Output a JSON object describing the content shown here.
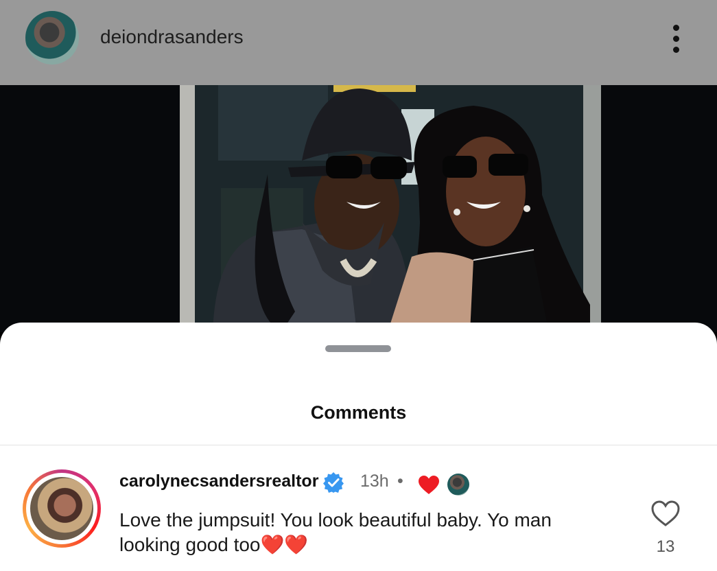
{
  "header": {
    "username": "deiondrasanders",
    "menu_icon": "more-vertical-icon"
  },
  "sheet": {
    "title": "Comments"
  },
  "comments": [
    {
      "username": "carolynecsandersrealtor",
      "verified": true,
      "time": "13h",
      "separator": "•",
      "author_liked": true,
      "text": "Love the jumpsuit! You look beautiful baby. Yo man looking good too❤️❤️",
      "like_count": "13"
    }
  ],
  "colors": {
    "header_bg": "#999999",
    "verified_blue": "#3897f0",
    "heart_red": "#ed1c24"
  }
}
